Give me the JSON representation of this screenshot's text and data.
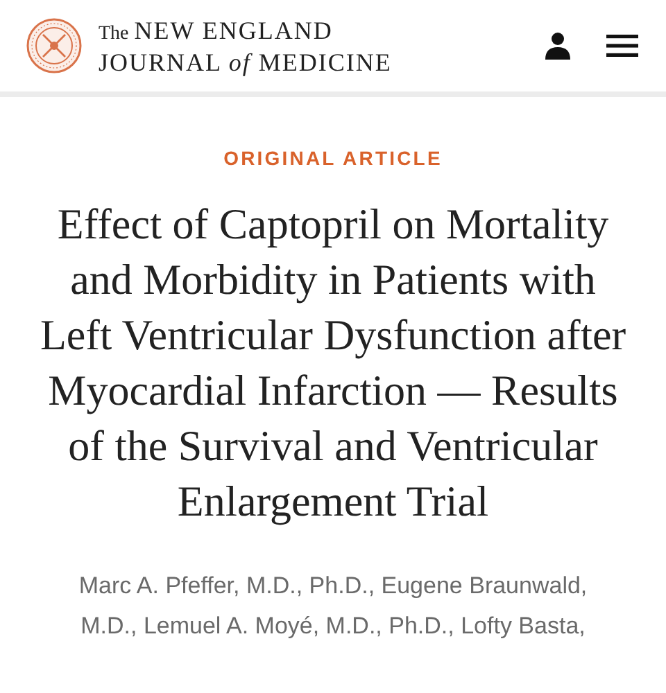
{
  "header": {
    "wordmark": {
      "prefix": "The",
      "line_1": "NEW ENGLAND",
      "line_2": "JOURNAL *of* MEDICINE"
    }
  },
  "article": {
    "category": "ORIGINAL ARTICLE",
    "title": "Effect of Captopril on Mortality and Morbidity in Patients with Left Ventricular Dysfunction after Myocardial Infarction — Results of the Survival and Ventricular Enlargement Trial",
    "authors": "Marc A. Pfeffer, M.D., Ph.D., Eugene Braunwald, M.D., Lemuel A. Moyé, M.D., Ph.D., Lofty Basta,"
  }
}
